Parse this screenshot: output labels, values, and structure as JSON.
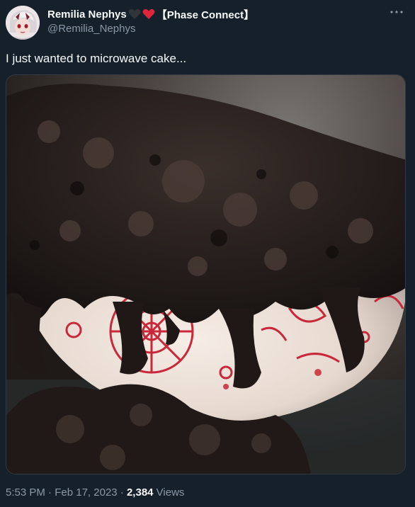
{
  "user": {
    "display_name": "Remilia Nephys",
    "name_suffix": "【Phase Connect】",
    "handle": "@Remilia_Nephys",
    "badge_emojis": [
      "black-heart",
      "red-heart"
    ]
  },
  "tweet": {
    "text": "I just wanted to microwave cake...",
    "image_alt": "Microwaved cake overflowing from a white bowl with red pattern"
  },
  "meta": {
    "time": "5:53 PM",
    "sep1": " · ",
    "date": "Feb 17, 2023",
    "sep2": " · ",
    "views_count": "2,384",
    "views_label": " Views"
  },
  "colors": {
    "background": "#15202b",
    "secondary_text": "#8b98a5",
    "heart_red": "#f91880"
  }
}
